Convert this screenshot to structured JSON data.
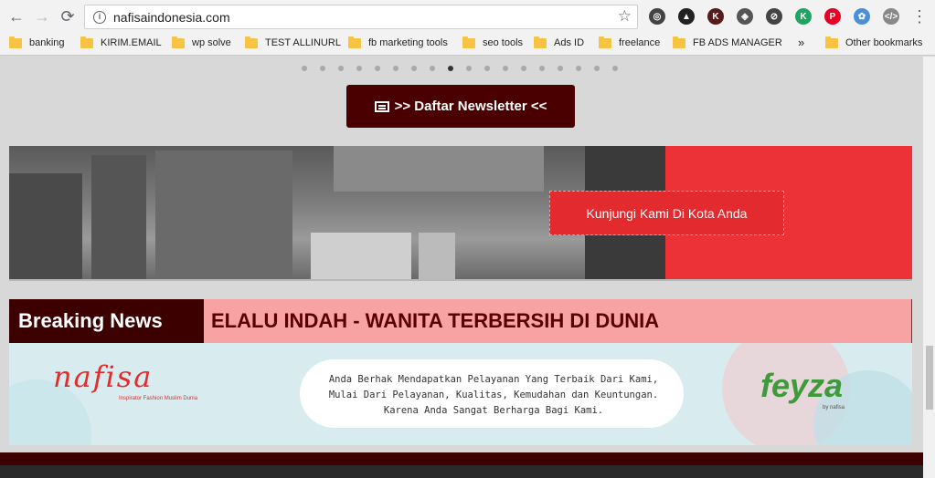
{
  "browser": {
    "url": "nafisaindonesia.com",
    "nav": {
      "back": "←",
      "forward": "→",
      "reload": "⟳"
    },
    "extensions": [
      {
        "name": "ext-1-icon",
        "glyph": "◎",
        "color": "#444"
      },
      {
        "name": "ext-2-icon",
        "glyph": "▲",
        "color": "#222"
      },
      {
        "name": "ext-3-icon",
        "glyph": "K",
        "color": "#5a1a1a"
      },
      {
        "name": "ext-4-icon",
        "glyph": "◈",
        "color": "#555"
      },
      {
        "name": "ext-5-icon",
        "glyph": "⊘",
        "color": "#444"
      },
      {
        "name": "ext-6-icon",
        "glyph": "K",
        "color": "#1fa463"
      },
      {
        "name": "pinterest-icon",
        "glyph": "P",
        "color": "#e60023"
      },
      {
        "name": "ext-8-icon",
        "glyph": "✿",
        "color": "#4a90d9"
      },
      {
        "name": "code-icon",
        "glyph": "</>",
        "color": "#888"
      }
    ]
  },
  "bookmarks": {
    "items": [
      "banking",
      "KIRIM.EMAIL",
      "wp solve",
      "TEST ALLINURL",
      "fb marketing tools",
      "seo tools",
      "Ads ID",
      "freelance",
      "FB ADS MANAGER"
    ],
    "overflow": "»",
    "other": "Other bookmarks"
  },
  "carousel": {
    "dot_count": 18,
    "active_index": 8
  },
  "newsletter": {
    "label": ">> Daftar Newsletter <<"
  },
  "store": {
    "cta": "Kunjungi Kami Di Kota Anda"
  },
  "breaking": {
    "label": "Breaking News",
    "ticker": "ELALU INDAH - WANITA TERBERSIH DI DUNIA"
  },
  "banner": {
    "brand": "nafisa",
    "tagline": "Inspirator Fashion Muslim Dunia",
    "text": [
      "Anda Berhak Mendapatkan Pelayanan Yang Terbaik Dari Kami,",
      "Mulai Dari Pelayanan, Kualitas, Kemudahan dan Keuntungan.",
      "Karena Anda Sangat Berharga Bagi Kami."
    ],
    "partner": "feyza",
    "partner_sub": "by nafisa"
  },
  "colors": {
    "accent": "#4a0000",
    "red": "#ec3237",
    "ticker_bg": "#f7a3a3"
  }
}
